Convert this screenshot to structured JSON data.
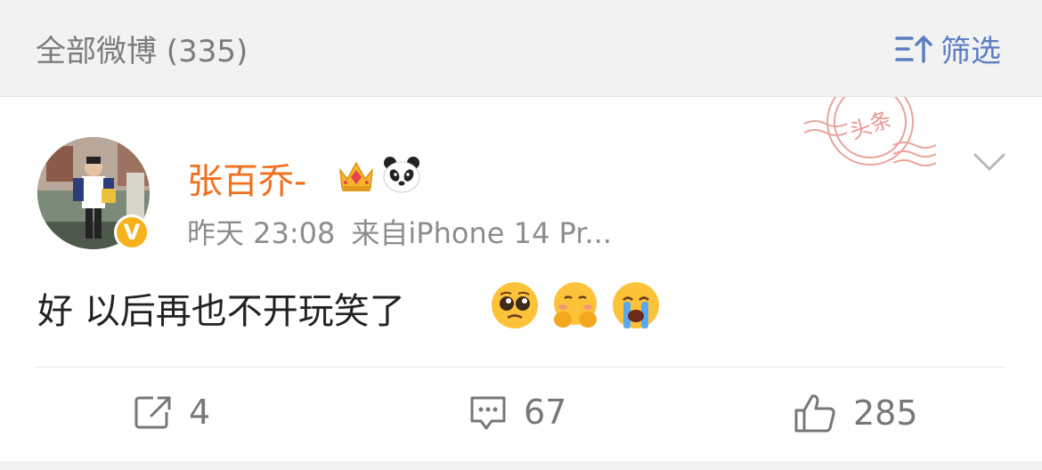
{
  "header": {
    "title": "全部微博 (335)",
    "filter_label": "筛选",
    "filter_icon": "filter-sort-icon"
  },
  "stamp": {
    "text": "头条"
  },
  "post": {
    "username": "张百乔-",
    "verified_badge": "V",
    "time": "昨天 23:08",
    "source": "来自iPhone 14 Pr...",
    "text": "好 以后再也不开玩笑了",
    "emojis": [
      "pleading-face",
      "hugging-face",
      "crying-face"
    ]
  },
  "actions": {
    "repost_count": "4",
    "comment_count": "67",
    "like_count": "285"
  },
  "colors": {
    "username": "#f0701d",
    "filter": "#5b7ec2",
    "badge": "#f6b21b",
    "stamp": "#e4847c"
  }
}
